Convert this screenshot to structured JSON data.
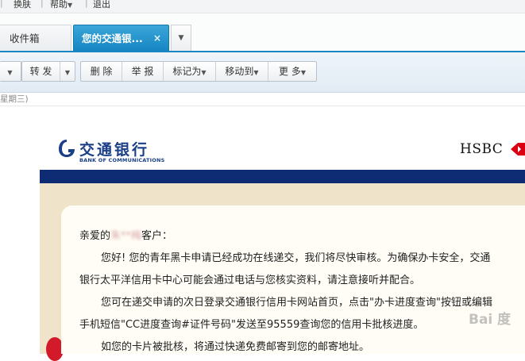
{
  "topbar": {
    "links": [
      "换肤",
      "帮助",
      "退出"
    ]
  },
  "tabs": [
    {
      "label": "收件箱"
    },
    {
      "label": "您的交通银...",
      "close": "×"
    }
  ],
  "toolbar": {
    "forward": "转 发",
    "delete": "删 除",
    "report": "举 报",
    "mark_as": "标记为",
    "move_to": "移动到",
    "more": "更 多"
  },
  "date_hint": "星期三)",
  "email": {
    "bank_cn": "交通银行",
    "bank_en": "BANK OF COMMUNICATIONS",
    "partner": "HSBC",
    "greeting_prefix": "亲爱的",
    "greeting_name_hidden": "朱**梅",
    "greeting_suffix": "客户：",
    "para1_line1": "您好! 您的青年黑卡申请已经成功在线递交，我们将尽快审核。为确保办卡安全，交通",
    "para1_line2": "银行太平洋信用卡中心可能会通过电话与您核实资料，请注意接听并配合。",
    "para2_line1": "您可在递交申请的次日登录交通银行信用卡网站首页，点击\"办卡进度查询\"按钮或编辑",
    "para2_line2": "手机短信\"CC进度查询#证件号码\"发送至95559查询您的信用卡批核进度。",
    "para3_line1": "如您的卡片被批核，将通过快递免费邮寄到您的邮寄地址。"
  },
  "watermark": "Bai 度"
}
